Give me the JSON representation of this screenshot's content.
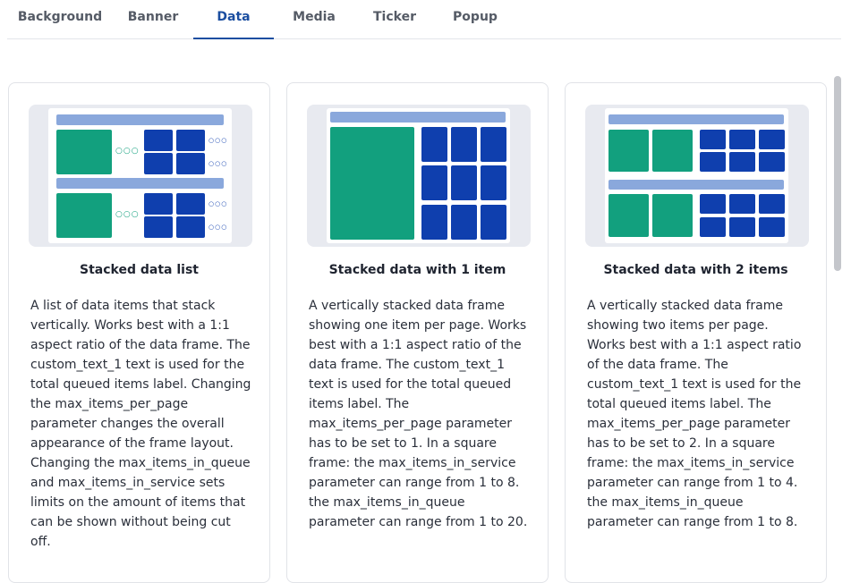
{
  "tabs": [
    {
      "label": "Background"
    },
    {
      "label": "Banner"
    },
    {
      "label": "Data",
      "active": true
    },
    {
      "label": "Media"
    },
    {
      "label": "Ticker"
    },
    {
      "label": "Popup"
    }
  ],
  "cards": [
    {
      "title": "Stacked data list",
      "description": "A list of data items that stack vertically. Works best with a 1:1 aspect ratio of the data frame. The custom_text_1 text is used for the total queued items label. Changing the max_items_per_page parameter changes the overall appearance of the frame layout. Changing the max_items_in_queue and max_items_in_service sets limits on the amount of items that can be shown without being cut off."
    },
    {
      "title": "Stacked data with 1 item",
      "description": "A vertically stacked data frame showing one item per page. Works best with a 1:1 aspect ratio of the data frame. The custom_text_1 text is used for the total queued items label. The max_items_per_page parameter has to be set to 1. In a square frame: the max_items_in_service parameter can range from 1 to 8. the max_items_in_queue parameter can range from 1 to 20."
    },
    {
      "title": "Stacked data with 2 items",
      "description": "A vertically stacked data frame showing two items per page. Works best with a 1:1 aspect ratio of the data frame. The custom_text_1 text is used for the total queued items label. The max_items_per_page parameter has to be set to 2. In a square frame: the max_items_in_service parameter can range from 1 to 4. the max_items_in_queue parameter can range from 1 to 8."
    }
  ],
  "colors": {
    "accent": "#1b4ea0",
    "thumb_green": "#12a07e",
    "thumb_blue": "#0f3fae",
    "thumb_bar": "#8aa8dc"
  }
}
